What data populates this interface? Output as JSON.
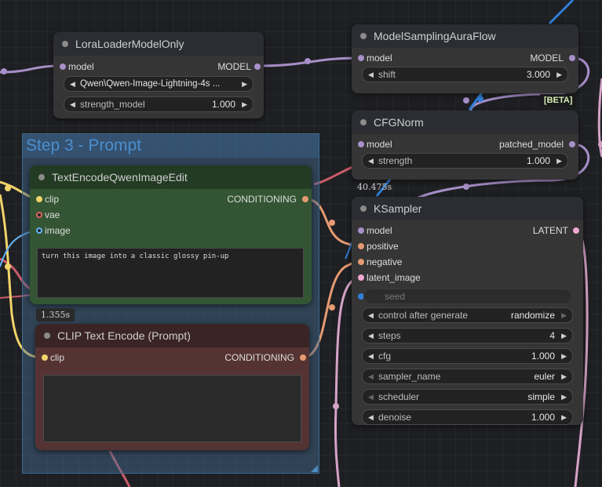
{
  "group": {
    "title": "Step 3 - Prompt"
  },
  "lora": {
    "title": "LoraLoaderModelOnly",
    "in_model": "model",
    "out_model": "MODEL",
    "lora_name": "Qwen\\Qwen-Image-Lightning-4s ...",
    "strength_label": "strength_model",
    "strength_value": "1.000"
  },
  "aura": {
    "title": "ModelSamplingAuraFlow",
    "in_model": "model",
    "out_model": "MODEL",
    "shift_label": "shift",
    "shift_value": "3.000",
    "badge": "[BETA]"
  },
  "cfgnorm": {
    "title": "CFGNorm",
    "in_model": "model",
    "out_model": "patched_model",
    "strength_label": "strength",
    "strength_value": "1.000",
    "timing": "40.475s"
  },
  "te_qwen": {
    "title": "TextEncodeQwenImageEdit",
    "in_clip": "clip",
    "in_vae": "vae",
    "in_image": "image",
    "out": "CONDITIONING",
    "prompt": "turn this image into a classic glossy pin-up",
    "timing": "1.355s"
  },
  "clip_enc": {
    "title": "CLIP Text Encode (Prompt)",
    "in_clip": "clip",
    "out": "CONDITIONING",
    "prompt": ""
  },
  "ksampler": {
    "title": "KSampler",
    "in_model": "model",
    "in_positive": "positive",
    "in_negative": "negative",
    "in_latent": "latent_image",
    "out": "LATENT",
    "seed_label": "seed",
    "widgets": [
      {
        "label": "control after generate",
        "value": "randomize"
      },
      {
        "label": "steps",
        "value": "4"
      },
      {
        "label": "cfg",
        "value": "1.000"
      },
      {
        "label": "sampler_name",
        "value": "euler"
      },
      {
        "label": "scheduler",
        "value": "simple"
      },
      {
        "label": "denoise",
        "value": "1.000"
      }
    ]
  },
  "colors": {
    "model_link": "#a78fc9",
    "conditioning_link": "#e59a72",
    "clip_link": "#f1d36b",
    "vae_link": "#e06363",
    "image_link": "#64b5f6",
    "latent_link": "#f0a8d0",
    "group_title": "#4b8fd0"
  }
}
